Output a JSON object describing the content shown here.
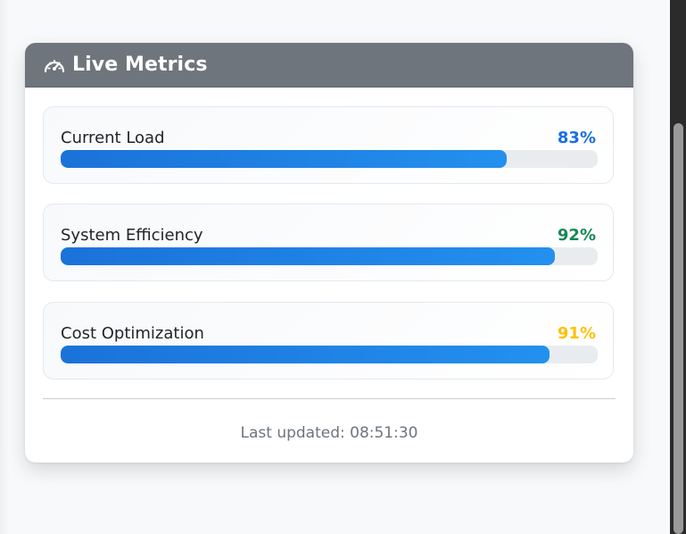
{
  "header": {
    "title": "Live Metrics",
    "icon": "speedometer-icon"
  },
  "metrics": [
    {
      "label": "Current Load",
      "value_text": "83%",
      "value": 83,
      "value_color": "#1a6fe0"
    },
    {
      "label": "System Efficiency",
      "value_text": "92%",
      "value": 92,
      "value_color": "#198754"
    },
    {
      "label": "Cost Optimization",
      "value_text": "91%",
      "value": 91,
      "value_color": "#ffc107"
    }
  ],
  "footer": {
    "last_updated": "Last updated: 08:51:30"
  },
  "colors": {
    "header_bg": "#6e757d",
    "bar_fill": "#1f86e8",
    "bar_track": "#e9ecef"
  }
}
